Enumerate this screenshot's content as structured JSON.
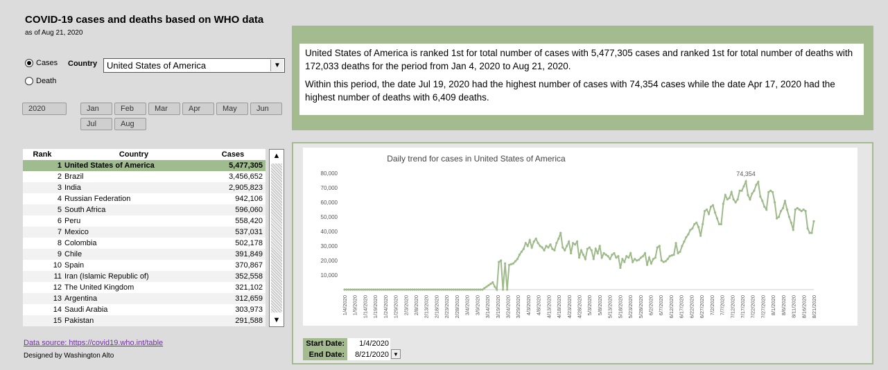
{
  "header": {
    "title": "COVID-19 cases and deaths based on WHO data",
    "subtitle": "as of Aug 21, 2020"
  },
  "options": {
    "cases_label": "Cases",
    "death_label": "Death",
    "selected": "Cases"
  },
  "country": {
    "label": "Country",
    "value": "United States of America"
  },
  "year_button": "2020",
  "months": [
    "Jan",
    "Feb",
    "Mar",
    "Apr",
    "May",
    "Jun",
    "Jul",
    "Aug"
  ],
  "ranking": {
    "headers": {
      "rank": "Rank",
      "country": "Country",
      "cases": "Cases"
    },
    "rows": [
      {
        "rank": "1",
        "country": "United States of America",
        "cases": "5,477,305"
      },
      {
        "rank": "2",
        "country": "Brazil",
        "cases": "3,456,652"
      },
      {
        "rank": "3",
        "country": "India",
        "cases": "2,905,823"
      },
      {
        "rank": "4",
        "country": "Russian Federation",
        "cases": "942,106"
      },
      {
        "rank": "5",
        "country": "South Africa",
        "cases": "596,060"
      },
      {
        "rank": "6",
        "country": "Peru",
        "cases": "558,420"
      },
      {
        "rank": "7",
        "country": "Mexico",
        "cases": "537,031"
      },
      {
        "rank": "8",
        "country": "Colombia",
        "cases": "502,178"
      },
      {
        "rank": "9",
        "country": "Chile",
        "cases": "391,849"
      },
      {
        "rank": "10",
        "country": "Spain",
        "cases": "370,867"
      },
      {
        "rank": "11",
        "country": "Iran (Islamic Republic of)",
        "cases": "352,558"
      },
      {
        "rank": "12",
        "country": "The United Kingdom",
        "cases": "321,102"
      },
      {
        "rank": "13",
        "country": "Argentina",
        "cases": "312,659"
      },
      {
        "rank": "14",
        "country": "Saudi Arabia",
        "cases": "303,973"
      },
      {
        "rank": "15",
        "country": "Pakistan",
        "cases": "291,588"
      }
    ]
  },
  "footer": {
    "source_link": "Data source: https://covid19.who.int/table",
    "designer": "Designed by Washington Alto"
  },
  "summary": {
    "p1": "United States of America is ranked 1st for total number of cases with 5,477,305 cases  and ranked 1st for total number of deaths with 172,033 deaths for the period from Jan 4, 2020 to Aug 21, 2020.",
    "p2": "Within this period, the date Jul 19, 2020 had the highest number of cases with 74,354 cases while the date Apr 17, 2020 had the highest number of deaths with 6,409 deaths."
  },
  "dates": {
    "start_label": "Start Date:",
    "start_value": "1/4/2020",
    "end_label": "End Date:",
    "end_value": "8/21/2020"
  },
  "colors": {
    "accent": "#a3bb8e",
    "line": "#9fba8a"
  },
  "chart_data": {
    "type": "line",
    "title": "Daily trend for cases in United States of America",
    "ylim": [
      0,
      80000
    ],
    "yticks": [
      "80,000",
      "70,000",
      "60,000",
      "50,000",
      "40,000",
      "30,000",
      "20,000",
      "10,000"
    ],
    "xticks": [
      "1/4/2020",
      "1/9/2020",
      "1/14/2020",
      "1/19/2020",
      "1/24/2020",
      "1/29/2020",
      "2/3/2020",
      "2/8/2020",
      "2/13/2020",
      "2/18/2020",
      "2/23/2020",
      "2/28/2020",
      "3/4/2020",
      "3/9/2020",
      "3/14/2020",
      "3/19/2020",
      "3/24/2020",
      "3/29/2020",
      "4/3/2020",
      "4/8/2020",
      "4/13/2020",
      "4/18/2020",
      "4/23/2020",
      "4/28/2020",
      "5/3/2020",
      "5/8/2020",
      "5/13/2020",
      "5/18/2020",
      "5/23/2020",
      "5/28/2020",
      "6/2/2020",
      "6/7/2020",
      "6/12/2020",
      "6/17/2020",
      "6/22/2020",
      "6/27/2020",
      "7/2/2020",
      "7/7/2020",
      "7/12/2020",
      "7/17/2020",
      "7/22/2020",
      "7/27/2020",
      "8/1/2020",
      "8/6/2020",
      "8/11/2020",
      "8/16/2020",
      "8/21/2020"
    ],
    "peak_label": "74,354",
    "series": [
      {
        "values": [
          0,
          0,
          0,
          0,
          0,
          0,
          0,
          0,
          0,
          0,
          0,
          0,
          0,
          0,
          0,
          0,
          0,
          0,
          0,
          0,
          0,
          0,
          0,
          0,
          0,
          0,
          0,
          0,
          0,
          0,
          0,
          0,
          0,
          0,
          0,
          0,
          0,
          0,
          0,
          0,
          0,
          0,
          0,
          0,
          0,
          0,
          0,
          0,
          0,
          0,
          0,
          0,
          0,
          0,
          0,
          0,
          0,
          0,
          0,
          0,
          0,
          0,
          0,
          0,
          0,
          0,
          0,
          0,
          1000,
          2000,
          3000,
          4000,
          5000,
          2000,
          0,
          19000,
          20000,
          0,
          18000,
          0,
          17000,
          17500,
          18000,
          19500,
          21000,
          24000,
          26000,
          28000,
          32000,
          30000,
          34000,
          29000,
          33000,
          35000,
          32000,
          30000,
          29000,
          27000,
          30000,
          29000,
          31000,
          28000,
          27000,
          32000,
          35000,
          39000,
          29000,
          27000,
          30000,
          33000,
          25000,
          32000,
          31000,
          33000,
          22000,
          27000,
          24000,
          21000,
          28000,
          29000,
          27000,
          21000,
          28000,
          25000,
          30000,
          22000,
          25000,
          24000,
          23000,
          21000,
          24000,
          25000,
          22000,
          23000,
          15000,
          21000,
          19000,
          23000,
          22000,
          25000,
          19000,
          21000,
          20000,
          20500,
          22000,
          23000,
          25000,
          17000,
          22000,
          18000,
          21000,
          22000,
          29000,
          30000,
          20000,
          19000,
          19500,
          21000,
          23000,
          23500,
          24000,
          32000,
          25000,
          26000,
          30000,
          33000,
          36000,
          38000,
          41000,
          42000,
          45000,
          46000,
          43000,
          37000,
          45000,
          54000,
          55000,
          52000,
          57000,
          58000,
          53000,
          49000,
          45000,
          45000,
          59000,
          65000,
          62000,
          63000,
          67000,
          62000,
          60000,
          62000,
          68000,
          68000,
          71000,
          74354,
          65000,
          62000,
          66000,
          68000,
          72000,
          74000,
          64000,
          61000,
          57000,
          55000,
          67000,
          68000,
          67000,
          60000,
          49000,
          50000,
          54000,
          56000,
          61000,
          55000,
          50000,
          46000,
          41000,
          55000,
          56000,
          55000,
          54000,
          55000,
          54000,
          42000,
          39000,
          39000,
          47000
        ]
      }
    ]
  }
}
